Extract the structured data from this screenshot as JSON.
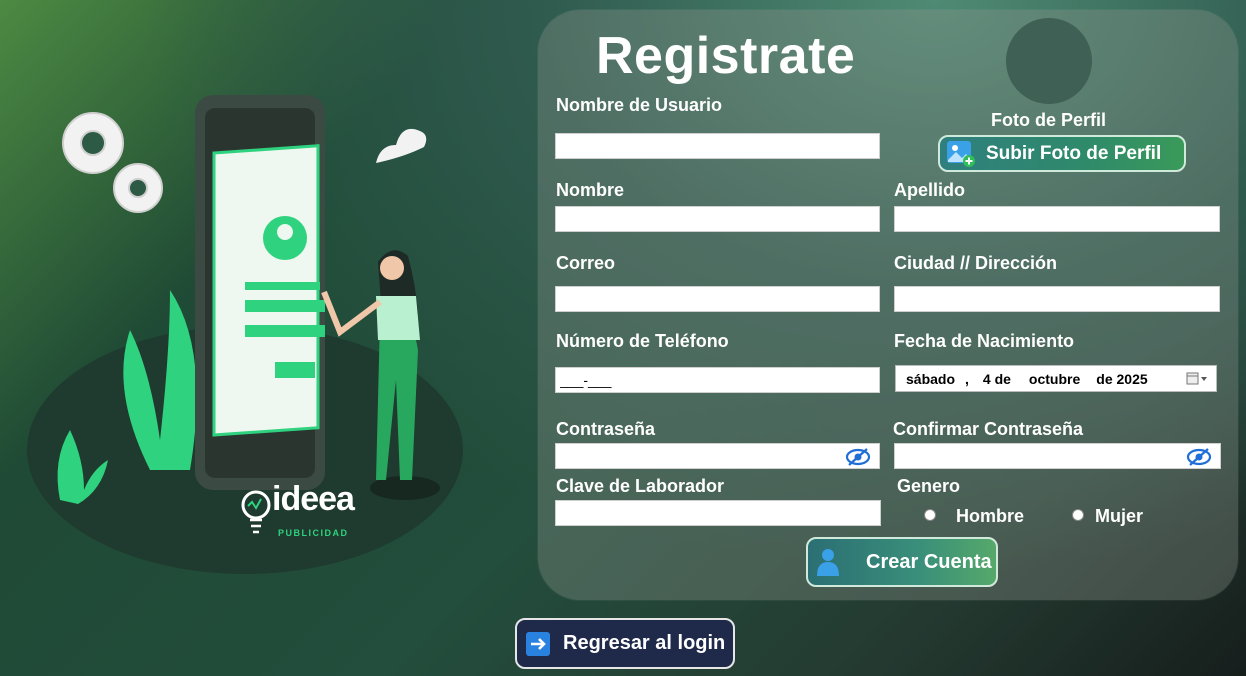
{
  "header": {
    "title": "Registrate"
  },
  "profile": {
    "label": "Foto de Perfil",
    "upload_label": "Subir Foto de Perfil"
  },
  "form": {
    "username": {
      "label": "Nombre de Usuario",
      "value": ""
    },
    "first_name": {
      "label": "Nombre",
      "value": ""
    },
    "last_name": {
      "label": "Apellido",
      "value": ""
    },
    "email": {
      "label": "Correo",
      "value": ""
    },
    "address": {
      "label": "Ciudad  // Dirección",
      "value": ""
    },
    "phone": {
      "label": "Número de Teléfono",
      "value": "___-___"
    },
    "birthdate": {
      "label": "Fecha de Nacimiento",
      "weekday": "sábado",
      "sep": ",",
      "day": "4 de",
      "month": "octubre",
      "year": "de 2025"
    },
    "password": {
      "label": "Contraseña",
      "value": ""
    },
    "confirm_password": {
      "label": "Confirmar Contraseña",
      "value": ""
    },
    "lab_key": {
      "label": "Clave de Laborador",
      "value": ""
    },
    "gender": {
      "label": "Genero",
      "options": [
        "Hombre",
        "Mujer"
      ]
    }
  },
  "actions": {
    "create_label": "Crear Cuenta",
    "back_label": "Regresar al login"
  },
  "brand": {
    "name": "ideea",
    "tagline": "PUBLICIDAD"
  },
  "colors": {
    "accent_green": "#2fd27e",
    "panel": "#8c968c",
    "back_btn": "#1f2a4a"
  }
}
